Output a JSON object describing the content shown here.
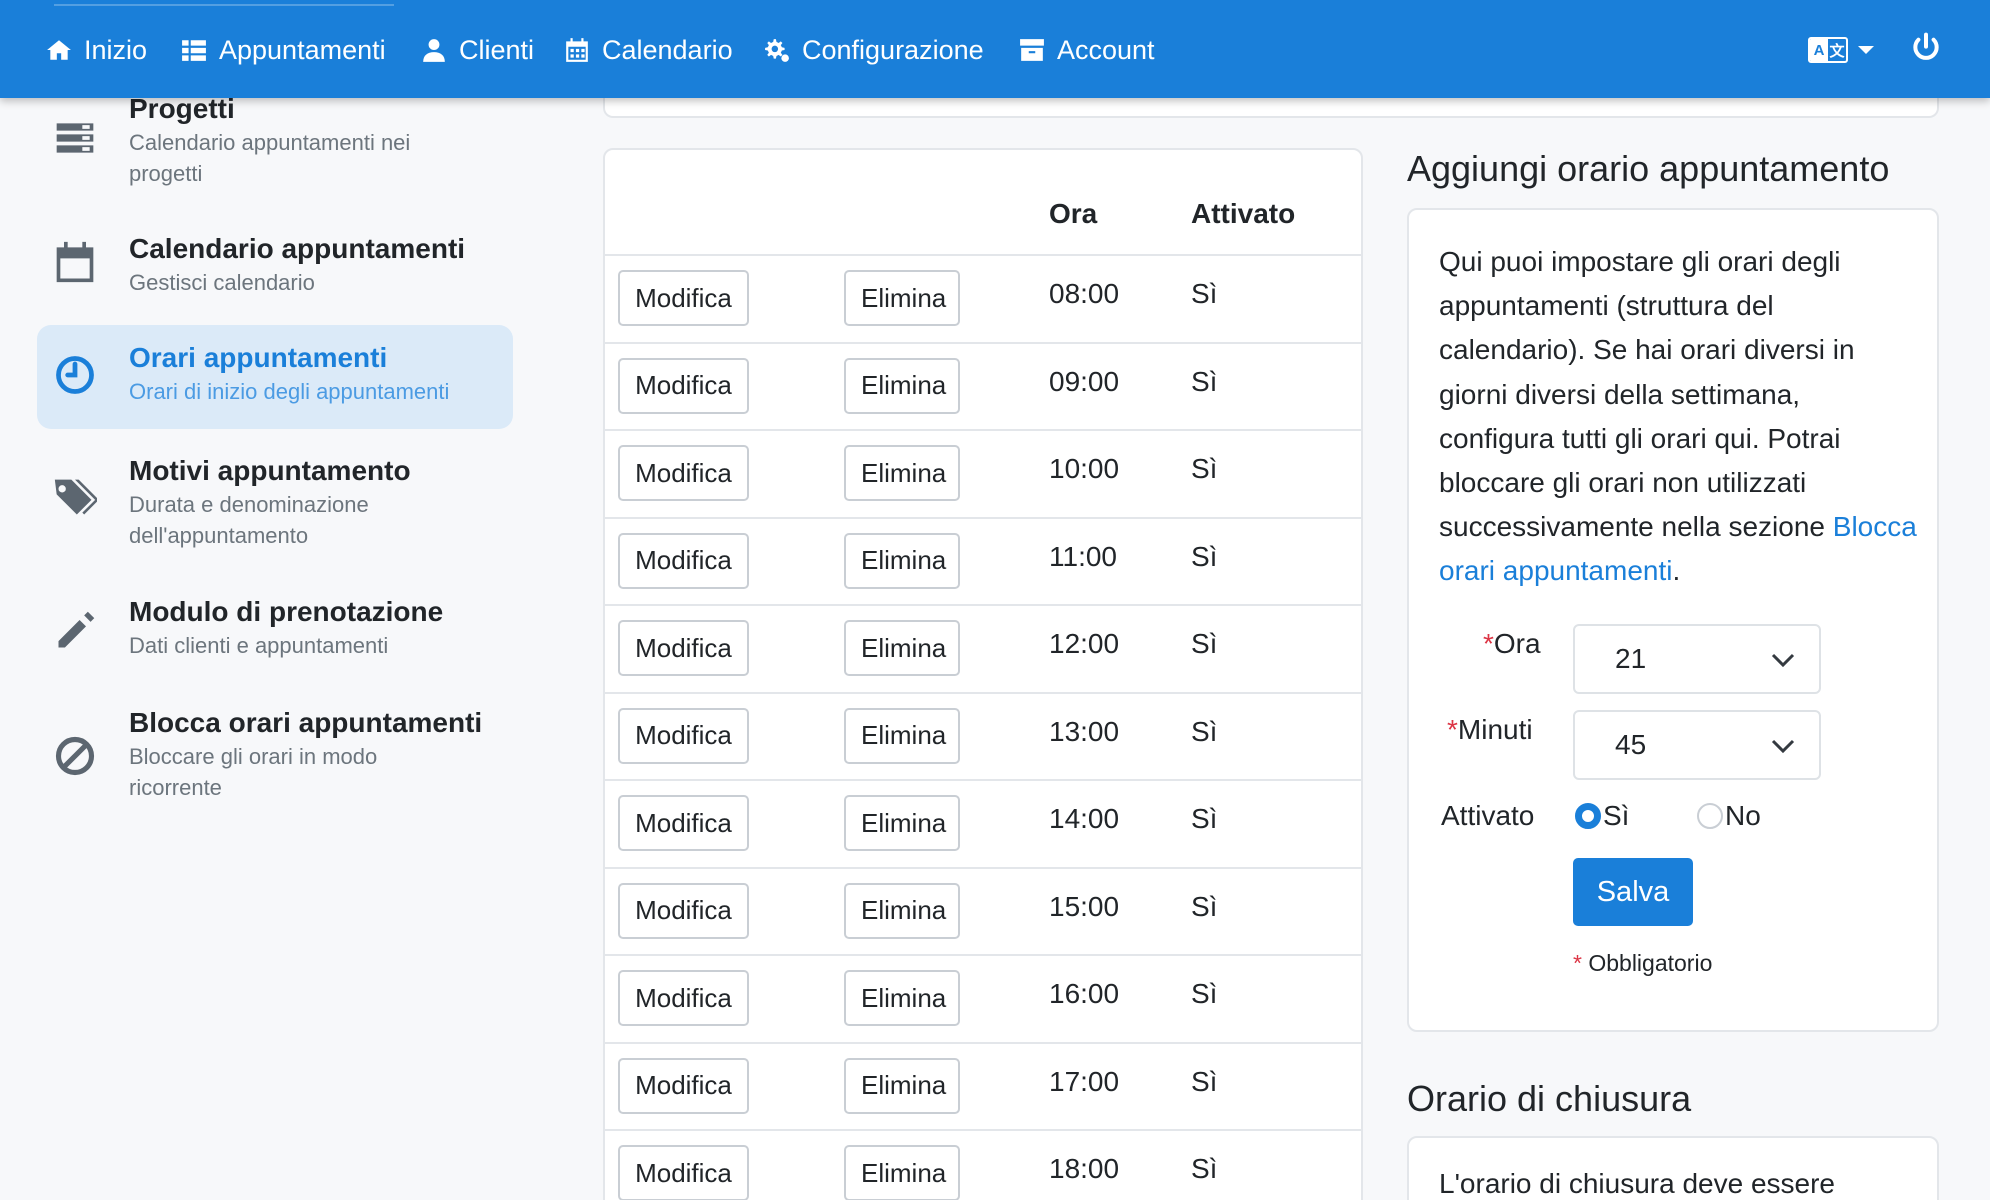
{
  "nav": {
    "items": [
      {
        "label": "Inizio",
        "icon": "home-icon"
      },
      {
        "label": "Appuntamenti",
        "icon": "list-icon"
      },
      {
        "label": "Clienti",
        "icon": "user-icon"
      },
      {
        "label": "Calendario",
        "icon": "calendar-icon"
      },
      {
        "label": "Configurazione",
        "icon": "gears-icon"
      },
      {
        "label": "Account",
        "icon": "archive-icon"
      }
    ],
    "language_icon": "language-icon",
    "power_icon": "power-icon"
  },
  "sidebar": {
    "items": [
      {
        "title": "Progetti",
        "desc": "Calendario appuntamenti nei progetti",
        "icon": "server-icon",
        "active": false
      },
      {
        "title": "Calendario appuntamenti",
        "desc": "Gestisci calendario",
        "icon": "calendar-icon",
        "active": false
      },
      {
        "title": "Orari appuntamenti",
        "desc": "Orari di inizio degli appuntamenti",
        "icon": "clock-icon",
        "active": true
      },
      {
        "title": "Motivi appuntamento",
        "desc": "Durata e denominazione dell'appuntamento",
        "icon": "tags-icon",
        "active": false
      },
      {
        "title": "Modulo di prenotazione",
        "desc": "Dati clienti e appuntamenti",
        "icon": "pencil-icon",
        "active": false
      },
      {
        "title": "Blocca orari appuntamenti",
        "desc": "Bloccare gli orari in modo ricorrente",
        "icon": "ban-icon",
        "active": false
      }
    ]
  },
  "table": {
    "headers": {
      "time": "Ora",
      "enabled": "Attivato"
    },
    "edit_label": "Modifica",
    "delete_label": "Elimina",
    "rows": [
      {
        "time": "08:00",
        "enabled": "Sì"
      },
      {
        "time": "09:00",
        "enabled": "Sì"
      },
      {
        "time": "10:00",
        "enabled": "Sì"
      },
      {
        "time": "11:00",
        "enabled": "Sì"
      },
      {
        "time": "12:00",
        "enabled": "Sì"
      },
      {
        "time": "13:00",
        "enabled": "Sì"
      },
      {
        "time": "14:00",
        "enabled": "Sì"
      },
      {
        "time": "15:00",
        "enabled": "Sì"
      },
      {
        "time": "16:00",
        "enabled": "Sì"
      },
      {
        "time": "17:00",
        "enabled": "Sì"
      },
      {
        "time": "18:00",
        "enabled": "Sì"
      }
    ]
  },
  "form": {
    "title": "Aggiungi orario appuntamento",
    "intro": "Qui puoi impostare gli orari degli appuntamenti (struttura del calendario). Se hai orari diversi in giorni diversi della settimana, configura tutti gli orari qui. Potrai bloccare gli orari non utilizzati successivamente nella sezione",
    "intro_link": "Blocca orari appuntamenti",
    "intro_end": ".",
    "hour_label": "Ora",
    "hour_value": "21",
    "minutes_label": "Minuti",
    "minutes_value": "45",
    "enabled_label": "Attivato",
    "yes_label": "Sì",
    "no_label": "No",
    "enabled_value": "Sì",
    "save_label": "Salva",
    "required_mark": "*",
    "required_note": "Obbligatorio"
  },
  "closing": {
    "title": "Orario di chiusura",
    "text": "L'orario di chiusura deve essere"
  },
  "colors": {
    "primary": "#1a7fd9",
    "active_bg": "#dbeaf8",
    "required": "#dc3545"
  }
}
